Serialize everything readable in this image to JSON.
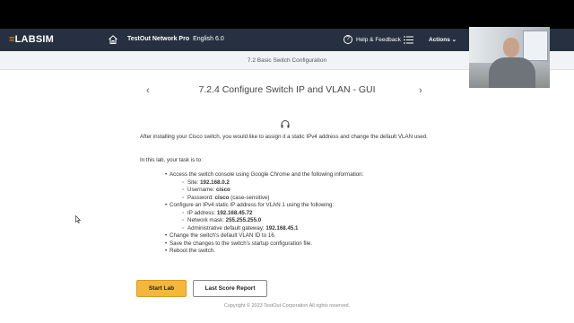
{
  "header": {
    "logo_text": "LABSIM",
    "course_title": "TestOut Network Pro",
    "language": "English 6.0",
    "help_label": "Help & Feedback",
    "actions_label": "Actions",
    "icons": [
      "home-icon",
      "question-circle-icon",
      "list-menu-icon",
      "chevron-down-icon"
    ]
  },
  "breadcrumb": "7.2 Basic Switch Configuration",
  "page": {
    "title": "7.2.4 Configure Switch IP and VLAN - GUI",
    "prev_arrow": "‹",
    "next_arrow": "›"
  },
  "intro": {
    "paragraph": "After installing your Cisco switch, you would like to assign it a static IPv4 address and change the default VLAN used.",
    "task_lead": "In this lab, your task is to:"
  },
  "tasks": {
    "t1": "Access the switch console using Google Chrome and the following information:",
    "t1_site_label": "Site: ",
    "t1_site_value": "192.168.0.2",
    "t1_user_label": "Username: ",
    "t1_user_value": "cisco",
    "t1_pass_label": "Password: ",
    "t1_pass_value": "cisco",
    "t1_pass_note": " (case-sensitive)",
    "t2": "Configure an IPv4 static IP address for VLAN 1 using the following:",
    "t2_ip_label": "IP address: ",
    "t2_ip_value": "192.168.45.72",
    "t2_mask_label": "Network mask: ",
    "t2_mask_value": "255.255.255.0",
    "t2_gw_label": "Administrative default gateway: ",
    "t2_gw_value": "192.168.45.1",
    "t3": "Change the switch's default VLAN ID to 16.",
    "t4": "Save the changes to the switch's startup configuration file.",
    "t5": "Reboot the switch."
  },
  "buttons": {
    "start_lab": "Start Lab",
    "last_score_report": "Last Score Report"
  },
  "footer": {
    "copyright": "Copyright © 2023 TestOut Corporation  All rights reserved."
  },
  "colors": {
    "header_bg": "#263040",
    "logo_accent": "#f08a24",
    "start_button": "#f4b63c"
  }
}
